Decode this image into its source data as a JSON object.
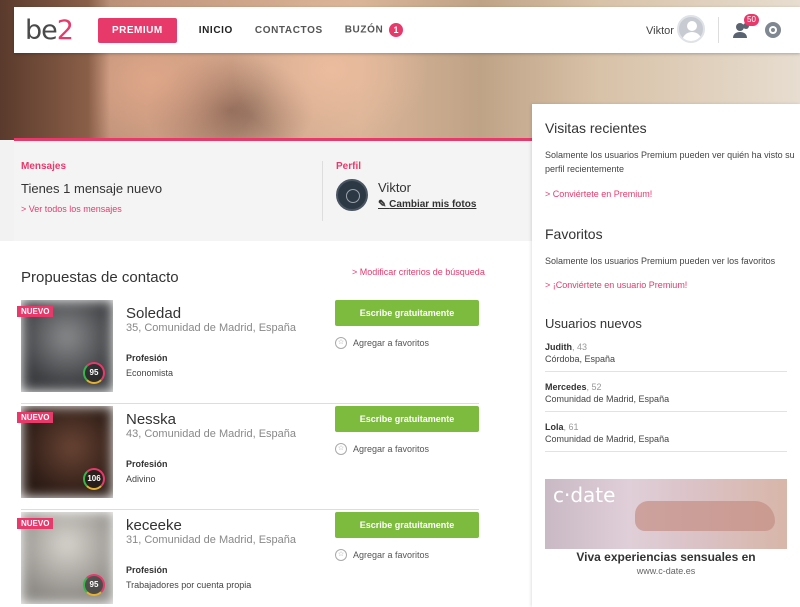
{
  "nav": {
    "logo_prefix": "be",
    "logo_suffix": "2",
    "premium": "PREMIUM",
    "inicio": "INICIO",
    "contactos": "CONTACTOS",
    "buzon": "BUZÓN",
    "buzon_badge": "1",
    "user_name": "Viktor",
    "contacts_badge": "50"
  },
  "messages": {
    "label": "Mensajes",
    "text": "Tienes 1 mensaje nuevo",
    "link": "> Ver todos los mensajes"
  },
  "profile": {
    "label": "Perfil",
    "name": "Viktor",
    "link": "Cambiar mis fotos"
  },
  "proposals": {
    "title": "Propuestas de contacto",
    "modify_link": "> Modificar criterios de búsqueda",
    "new_badge": "NUEVO",
    "profession_label": "Profesión",
    "write_label": "Escribe gratuitamente",
    "fav_label": "Agregar a favoritos",
    "items": [
      {
        "name": "Soledad",
        "meta": "35, Comunidad de Madrid, España",
        "profession": "Economista",
        "score": "95"
      },
      {
        "name": "Nesska",
        "meta": "43, Comunidad de Madrid, España",
        "profession": "Adivino",
        "score": "106"
      },
      {
        "name": "keceeke",
        "meta": "31, Comunidad de Madrid, España",
        "profession": "Trabajadores por cuenta propia",
        "score": "95"
      }
    ]
  },
  "sidebar": {
    "visits_title": "Visitas recientes",
    "visits_text": "Solamente los usuarios Premium pueden ver quién ha visto su perfil recientemente",
    "visits_link": "> Conviértete en Premium!",
    "fav_title": "Favoritos",
    "fav_text": "Solamente los usuarios Premium pueden ver los favoritos",
    "fav_link": "> ¡Conviértete en usuario Premium!",
    "new_users_title": "Usuarios nuevos",
    "new_users": [
      {
        "name": "Judith",
        "age": ", 43",
        "location": "Córdoba, España"
      },
      {
        "name": "Mercedes",
        "age": ", 52",
        "location": "Comunidad de Madrid, España"
      },
      {
        "name": "Lola",
        "age": ", 61",
        "location": "Comunidad de Madrid, España"
      }
    ],
    "ad_logo": "c·date",
    "ad_text": "Viva experiencias sensuales en",
    "ad_url": "www.c-date.es"
  }
}
